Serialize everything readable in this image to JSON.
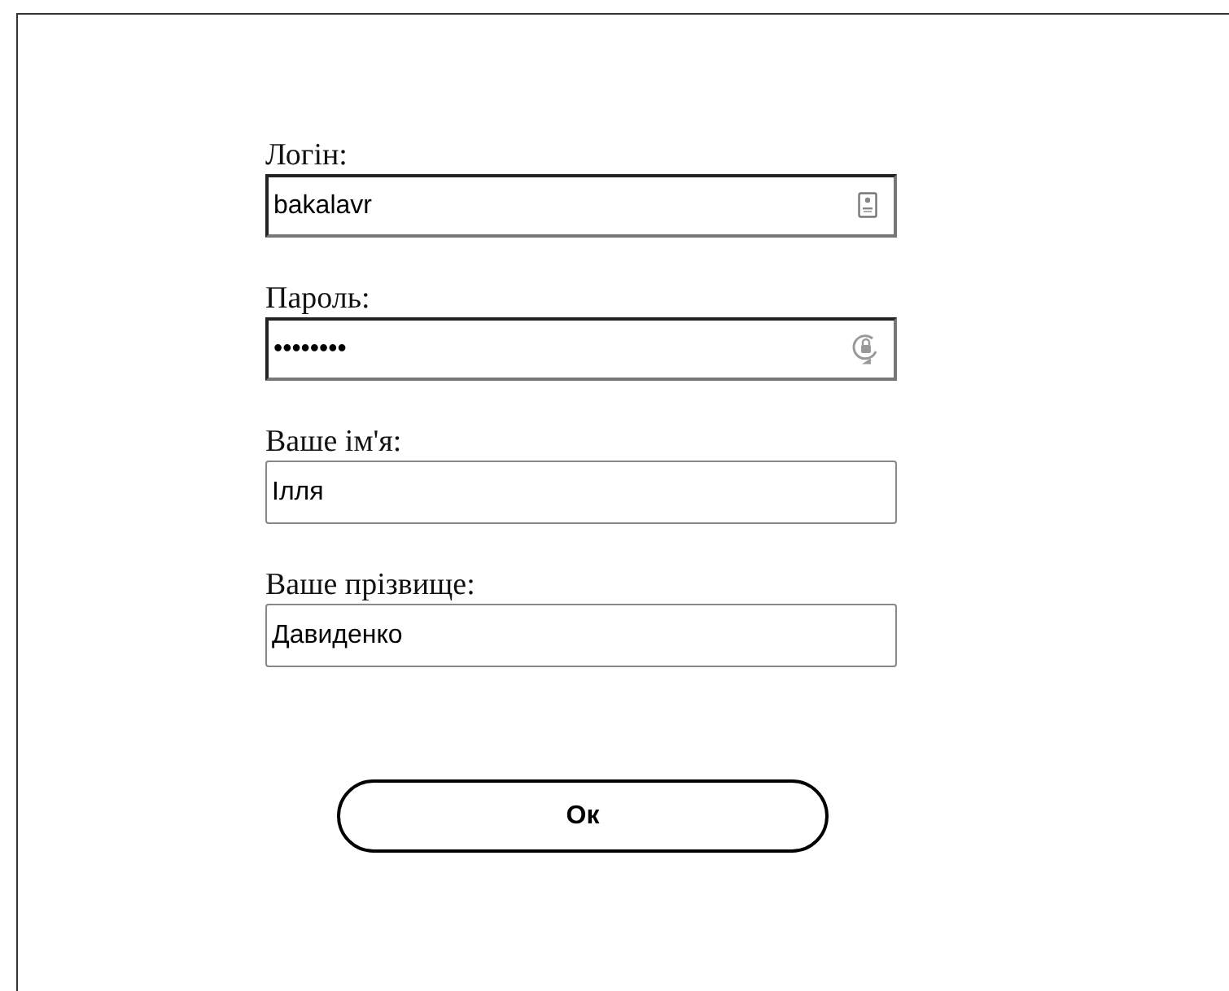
{
  "form": {
    "fields": [
      {
        "label": "Логін:",
        "value": "bakalavr",
        "kind": "login"
      },
      {
        "label": "Пароль:",
        "value": "••••••••",
        "kind": "password"
      },
      {
        "label": "Ваше ім'я:",
        "value": "Ілля",
        "kind": "plain"
      },
      {
        "label": "Ваше прізвище:",
        "value": "Давиденко",
        "kind": "plain"
      }
    ],
    "submit": "Ок"
  }
}
